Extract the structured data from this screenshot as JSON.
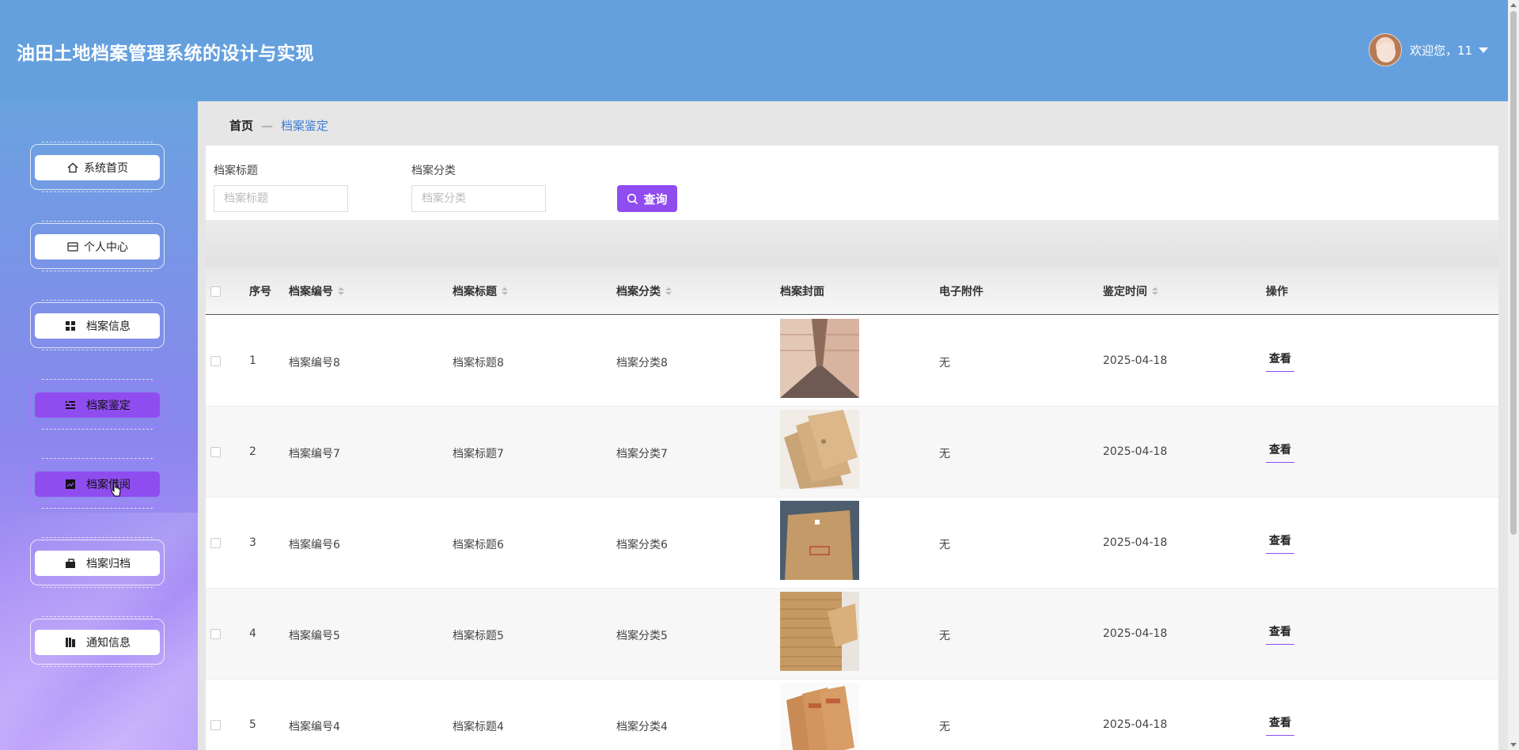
{
  "header": {
    "title": "油田土地档案管理系统的设计与实现",
    "welcome": "欢迎您，11"
  },
  "sidebar": {
    "items": [
      {
        "label": "系统首页",
        "icon": "home-icon",
        "active": false
      },
      {
        "label": "个人中心",
        "icon": "wallet-icon",
        "active": false
      },
      {
        "label": "档案信息",
        "icon": "grid-icon",
        "active": false
      },
      {
        "label": "档案鉴定",
        "icon": "list-icon",
        "active": true
      },
      {
        "label": "档案借阅",
        "icon": "chart-icon",
        "active": true
      },
      {
        "label": "档案归档",
        "icon": "briefcase-icon",
        "active": false
      },
      {
        "label": "通知信息",
        "icon": "book-icon",
        "active": false
      }
    ]
  },
  "breadcrumb": {
    "home": "首页",
    "separator": "—",
    "current": "档案鉴定"
  },
  "search": {
    "title_label": "档案标题",
    "title_placeholder": "档案标题",
    "category_label": "档案分类",
    "category_placeholder": "档案分类",
    "query_label": "查询"
  },
  "table": {
    "headers": {
      "index": "序号",
      "code": "档案编号",
      "title": "档案标题",
      "category": "档案分类",
      "cover": "档案封面",
      "attachment": "电子附件",
      "time": "鉴定时间",
      "action": "操作"
    },
    "rows": [
      {
        "index": "1",
        "code": "档案编号8",
        "title": "档案标题8",
        "category": "档案分类8",
        "attachment": "无",
        "time": "2025-04-18",
        "action": "查看"
      },
      {
        "index": "2",
        "code": "档案编号7",
        "title": "档案标题7",
        "category": "档案分类7",
        "attachment": "无",
        "time": "2025-04-18",
        "action": "查看"
      },
      {
        "index": "3",
        "code": "档案编号6",
        "title": "档案标题6",
        "category": "档案分类6",
        "attachment": "无",
        "time": "2025-04-18",
        "action": "查看"
      },
      {
        "index": "4",
        "code": "档案编号5",
        "title": "档案标题5",
        "category": "档案分类5",
        "attachment": "无",
        "time": "2025-04-18",
        "action": "查看"
      },
      {
        "index": "5",
        "code": "档案编号4",
        "title": "档案标题4",
        "category": "档案分类4",
        "attachment": "无",
        "time": "2025-04-18",
        "action": "查看"
      }
    ]
  },
  "colors": {
    "header_bg": "#65a0de",
    "accent": "#8f4df0",
    "link": "#3a7bd5"
  }
}
